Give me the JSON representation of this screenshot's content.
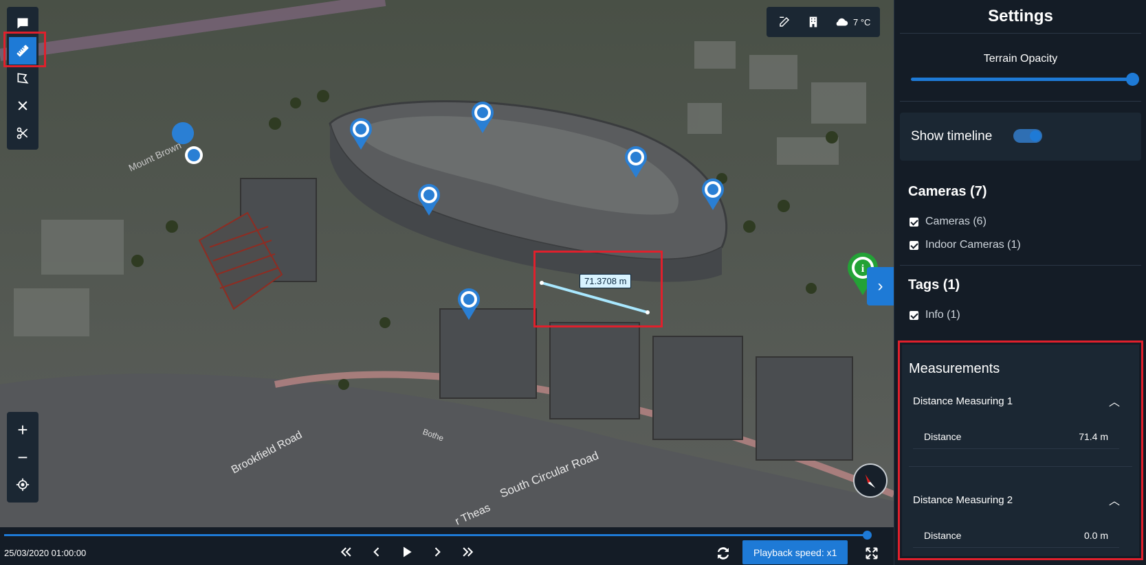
{
  "toolbar": {
    "tools": [
      "comment-icon",
      "ruler-icon",
      "polygon-icon",
      "close-icon",
      "scissors-icon"
    ],
    "zoom_in": "+",
    "zoom_out": "−"
  },
  "top_controls": {
    "temperature": "7 °C"
  },
  "map": {
    "measurement_label": "71.3708 m",
    "street_labels": [
      "Brookfield Road",
      "South Circular Road",
      "Mount Brown",
      "Bothe",
      "r Theas"
    ]
  },
  "timeline": {
    "datetime": "25/03/2020 01:00:00",
    "playback_speed": "Playback speed: x1"
  },
  "settings": {
    "title": "Settings",
    "terrain_opacity_label": "Terrain Opacity",
    "terrain_opacity_value": 1.0,
    "show_timeline_label": "Show timeline",
    "show_timeline_on": true,
    "cameras": {
      "header": "Cameras (7)",
      "items": [
        "Cameras (6)",
        "Indoor Cameras (1)"
      ]
    },
    "tags": {
      "header": "Tags (1)",
      "items": [
        "Info (1)"
      ]
    },
    "measurements": {
      "header": "Measurements",
      "items": [
        {
          "name": "Distance Measuring 1",
          "key": "Distance",
          "value": "71.4 m"
        },
        {
          "name": "Distance Measuring 2",
          "key": "Distance",
          "value": "0.0 m"
        }
      ]
    }
  },
  "colors": {
    "accent": "#1e7ad6",
    "panel_bg": "#141c26",
    "highlight": "#e0202c"
  }
}
